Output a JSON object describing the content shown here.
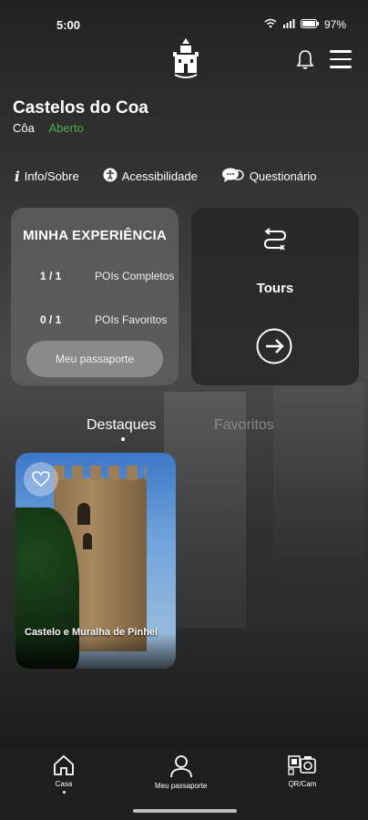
{
  "status": {
    "time": "5:00",
    "battery": "97%"
  },
  "header": {
    "title": "Castelos do Coa",
    "region": "Côa",
    "state": "Aberto"
  },
  "links": [
    {
      "label": "Info/Sobre"
    },
    {
      "label": "Acessibilidade"
    },
    {
      "label": "Questionário"
    }
  ],
  "experience": {
    "heading": "MINHA EXPERIÊNCIA",
    "completed_value": "1 / 1",
    "completed_label": "POIs Completos",
    "favorites_value": "0 / 1",
    "favorites_label": "POIs Favoritos",
    "passport_button": "Meu passaporte"
  },
  "tours": {
    "label": "Tours"
  },
  "tabs": {
    "highlights": "Destaques",
    "favorites": "Favoritos"
  },
  "poi": {
    "name": "Castelo e Muralha de Pinhel"
  },
  "nav": {
    "home": "Casa",
    "passport": "Meu passaporte",
    "qr": "QR/Cam"
  },
  "colors": {
    "open_status": "#4caf50"
  }
}
